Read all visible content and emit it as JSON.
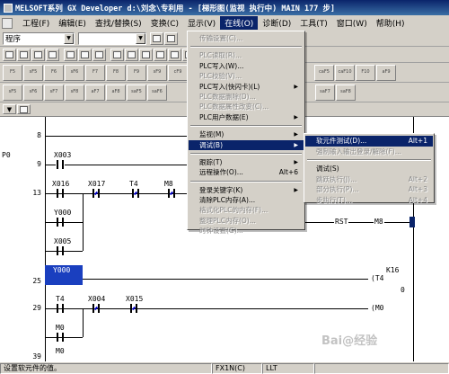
{
  "window": {
    "title": "MELSOFT系列 GX Developer d:\\刘念\\专利用 - [梯形图(监视 执行中)        MAIN     177 步]"
  },
  "menubar": {
    "items": [
      {
        "label": "工程(F)"
      },
      {
        "label": "编辑(E)"
      },
      {
        "label": "查找/替换(S)"
      },
      {
        "label": "变换(C)"
      },
      {
        "label": "显示(V)"
      },
      {
        "label": "在线(O)"
      },
      {
        "label": "诊断(D)"
      },
      {
        "label": "工具(T)"
      },
      {
        "label": "窗口(W)"
      },
      {
        "label": "帮助(H)"
      }
    ],
    "active_index": 5
  },
  "toolbar": {
    "program_select": "程序",
    "device_select": "",
    "fkeys": [
      "F5",
      "sF5",
      "F6",
      "sF6",
      "F7",
      "F8",
      "F9",
      "sF9",
      "cF9",
      "cF10",
      "sF7",
      "sF8",
      "aF7",
      "aF8",
      "aF5",
      "caF5",
      "caF10",
      "F10",
      "aF9"
    ],
    "fkeys2": [
      "sF5",
      "sF6",
      "sF7",
      "sF8",
      "aF7",
      "aF8",
      "saF5",
      "saF6",
      "saF7",
      "saF8"
    ]
  },
  "online_menu": {
    "items": [
      {
        "label": "传输设置(C)...",
        "enabled": false
      },
      {
        "sep": true
      },
      {
        "label": "PLC读取(R)...",
        "enabled": false
      },
      {
        "label": "PLC写入(W)...",
        "enabled": true
      },
      {
        "label": "PLC校验(V)...",
        "enabled": false
      },
      {
        "label": "PLC写入(快闪卡)(L)",
        "enabled": true,
        "submenu": true
      },
      {
        "label": "PLC数据删除(D)...",
        "enabled": false
      },
      {
        "label": "PLC数据属性改变(C)...",
        "enabled": false
      },
      {
        "label": "PLC用户数据(E)",
        "enabled": true,
        "submenu": true
      },
      {
        "sep": true
      },
      {
        "label": "监视(M)",
        "enabled": true,
        "submenu": true
      },
      {
        "label": "调试(B)",
        "enabled": true,
        "submenu": true,
        "highlighted": true
      },
      {
        "sep": true
      },
      {
        "label": "跟踪(T)",
        "enabled": true,
        "submenu": true
      },
      {
        "label": "远程操作(O)...",
        "shortcut": "Alt+6",
        "enabled": true
      },
      {
        "sep": true
      },
      {
        "label": "登录关键字(K)",
        "enabled": true,
        "submenu": true
      },
      {
        "label": "清除PLC内存(A)...",
        "enabled": true
      },
      {
        "label": "格式化PLC的内存(F)...",
        "enabled": false
      },
      {
        "label": "整理PLC内存(O)...",
        "enabled": false
      },
      {
        "label": "时钟设置(G)...",
        "enabled": false
      }
    ]
  },
  "debug_submenu": {
    "items": [
      {
        "label": "软元件测试(D)...",
        "shortcut": "Alt+1",
        "enabled": true,
        "highlighted": true
      },
      {
        "label": "强制输入输出登录/解除(F)...",
        "enabled": false
      },
      {
        "sep": true
      },
      {
        "label": "调试(S)",
        "enabled": true
      },
      {
        "label": "跳跃执行(J)...",
        "shortcut": "Alt+2",
        "enabled": false
      },
      {
        "label": "部分执行(P)...",
        "shortcut": "Alt+3",
        "enabled": false
      },
      {
        "label": "步执行(T)...",
        "shortcut": "Alt+4",
        "enabled": false
      }
    ]
  },
  "ladder": {
    "step_numbers": [
      "8",
      "9",
      "13",
      "25",
      "29",
      "39"
    ],
    "p_label": "P0",
    "contacts": [
      "X003",
      "X016",
      "X017",
      "T4",
      "M8",
      "Y000",
      "X005",
      "Y000",
      "T4",
      "X004",
      "X015",
      "M0",
      "M0"
    ],
    "coils": [
      "RST",
      "M8",
      "T4",
      "M0",
      "K16",
      "0"
    ]
  },
  "status": {
    "message": "设置软元件的值。",
    "cpu": "FX1N(C)",
    "mode": "LLT"
  },
  "watermark": "Bai@经验"
}
